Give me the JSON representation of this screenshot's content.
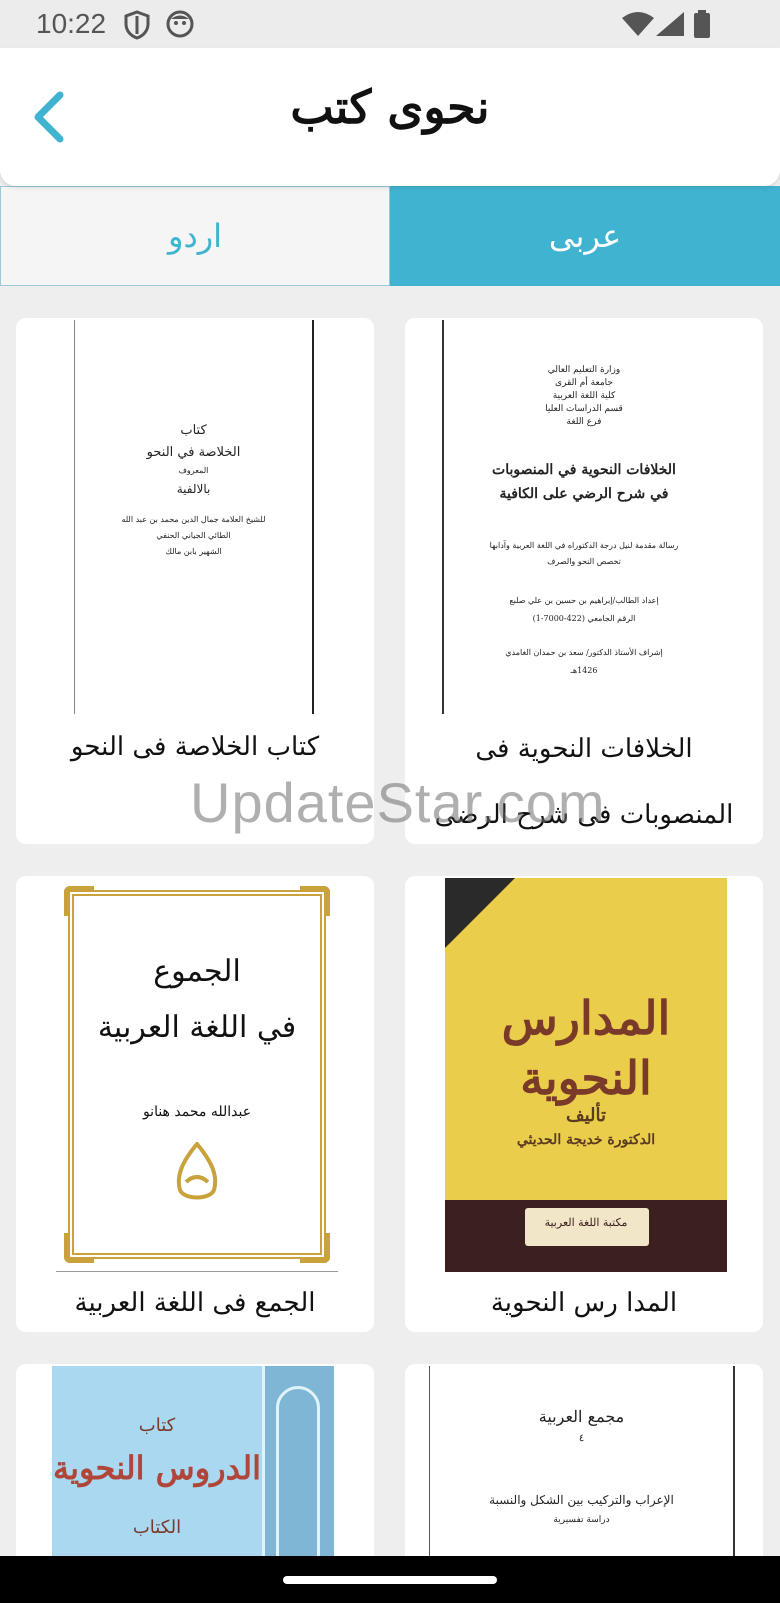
{
  "status_bar": {
    "time": "10:22"
  },
  "header": {
    "title": "نحوی کتب"
  },
  "tabs": [
    {
      "label": "اردو",
      "selected": false
    },
    {
      "label": "عربی",
      "selected": true
    }
  ],
  "books": [
    {
      "title": "الخلافات النحوية فی المنصوبات فی شرح الرضی علی الکافیة",
      "cover_lines": [
        "وزارة التعليم العالي",
        "جامعة أم القرى",
        "كلية اللغة العربية",
        "قسم الدراسات العليا",
        "فرع اللغة",
        "الخلافات النحوية في المنصوبات",
        "في شرح الرضي على الكافية",
        "رسالة مقدمة لنيل درجة الدكتوراه في اللغة العربية وآدابها",
        "تخصص النحو والصرف",
        "إعداد الطالب/إبراهيم بن حسين بن علي صلبع",
        "الرقم الجامعي (422-7000-1)",
        "إشراف الأستاذ الدكتور/ سعد بن حمدان الغامدي",
        "1426هـ"
      ]
    },
    {
      "title": "کتاب الخلاصة فی النحو",
      "cover_lines": [
        "كتاب",
        "الخلاصة في النحو",
        "المعروف",
        "بالالفية",
        "للشيخ العلامة جمال الدين محمد بن عبد الله",
        "الطائي الجياني الحنفي",
        "الشهير بابن مالك"
      ]
    },
    {
      "title": "المدا رس النحویة",
      "cover_lines": [
        "المدارس النحوية",
        "تأليف",
        "الدكتورة خديجة الحديثي",
        "مكتبة اللغة العربية"
      ]
    },
    {
      "title": "الجمع فی اللغة العربية",
      "cover_lines": [
        "الجموع",
        "في اللغة العربية",
        "عبدالله محمد هنانو"
      ]
    },
    {
      "title": "",
      "cover_lines": [
        "مجمع العربية",
        "٤",
        "الإعراب والتركيب بين الشكل والنسبة",
        "دراسة تفسيرية"
      ]
    },
    {
      "title": "",
      "cover_lines": [
        "كتاب",
        "الدروس النحوية",
        "الكتاب"
      ]
    }
  ],
  "watermark": "UpdateStar.com",
  "colors": {
    "accent": "#40b3d0",
    "background": "#eeeeee",
    "card": "#ffffff"
  },
  "icons": {
    "back": "chevron-left-icon",
    "shield": "shield-icon",
    "face": "face-icon",
    "wifi": "wifi-icon",
    "signal": "signal-icon",
    "battery": "battery-icon"
  }
}
